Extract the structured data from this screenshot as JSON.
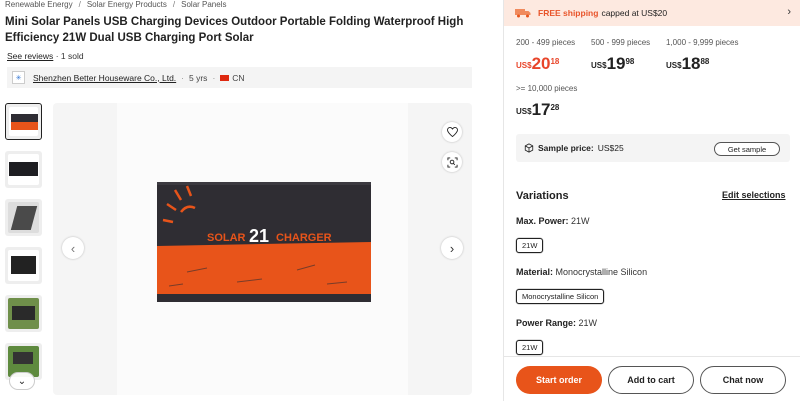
{
  "breadcrumb": [
    "Renewable Energy",
    "Solar Energy Products",
    "Solar Panels"
  ],
  "product": {
    "title": "Mini Solar Panels USB Charging Devices Outdoor Portable Folding Waterproof High Efficiency 21W Dual USB Charging Port Solar",
    "reviews_link": "See reviews",
    "sold": "· 1 sold",
    "image_text_left": "SOLAR",
    "image_text_number": "21",
    "image_text_right": "CHARGER"
  },
  "supplier": {
    "name": "Shenzhen Better Houseware Co., Ltd.",
    "years": "5 yrs",
    "country": "CN"
  },
  "shipping": {
    "free": "FREE shipping",
    "rest": "capped at US$20"
  },
  "tiers": [
    {
      "range": "200 - 499 pieces",
      "cur": "US$",
      "int": "20",
      "dec": "18"
    },
    {
      "range": "500 - 999 pieces",
      "cur": "US$",
      "int": "19",
      "dec": "98"
    },
    {
      "range": "1,000 - 9,999 pieces",
      "cur": "US$",
      "int": "18",
      "dec": "88"
    },
    {
      "range": ">= 10,000 pieces",
      "cur": "US$",
      "int": "17",
      "dec": "28"
    }
  ],
  "sample": {
    "label": "Sample price:",
    "value": "US$25",
    "button": "Get sample"
  },
  "variations": {
    "title": "Variations",
    "edit": "Edit selections",
    "attrs": [
      {
        "label": "Max. Power:",
        "value": "21W",
        "chip": "21W"
      },
      {
        "label": "Material:",
        "value": "Monocrystalline Silicon",
        "chip": "Monocrystalline Silicon"
      },
      {
        "label": "Power Range:",
        "value": "21W",
        "chip": "21W"
      }
    ]
  },
  "actions": {
    "start_order": "Start order",
    "add_to_cart": "Add to cart",
    "chat_now": "Chat now"
  },
  "colors": {
    "accent": "#e8541a",
    "price_red": "#e8452a",
    "shipping_bg": "#fde9e0"
  }
}
